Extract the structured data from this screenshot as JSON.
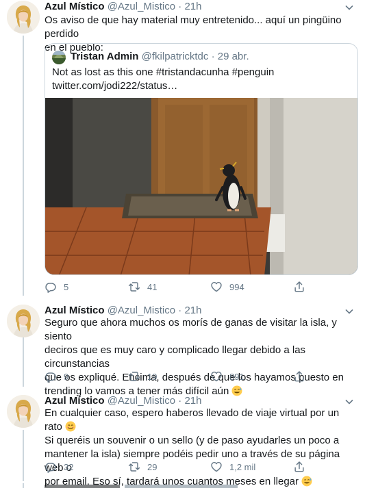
{
  "tweets": [
    {
      "name": "Azul Místico",
      "handle": "@Azul_Mistico",
      "sep": "·",
      "time": "21h",
      "text_lines": [
        "Os aviso de que hay material muy entretenido... aquí un pingüino perdido",
        "en el pueblo:"
      ],
      "quote": {
        "name": "Tristan Admin",
        "handle": "@fkilpatricktdc",
        "sep": "·",
        "time": "29 abr.",
        "text_lines": [
          "Not as lost as this one #tristandacunha #penguin",
          "twitter.com/jodi222/status…"
        ],
        "media_icon": "penguin-photo"
      },
      "replies": "5",
      "retweets": "41",
      "likes": "994"
    },
    {
      "name": "Azul Místico",
      "handle": "@Azul_Mistico",
      "sep": "·",
      "time": "21h",
      "text_lines": [
        "Seguro que ahora muchos os morís de ganas de visitar la isla, y siento",
        "deciros que es muy caro y complicado llegar debido a las circunstancias",
        "que os expliqué. Encima, después de que los hayamos puesto en",
        "trending lo vamos a tener más difícil aún"
      ],
      "replies": "9",
      "retweets": "19",
      "likes": "891"
    },
    {
      "name": "Azul Místico",
      "handle": "@Azul_Mistico",
      "sep": "·",
      "time": "21h",
      "text_lines": [
        "En cualquier caso, espero haberos llevado de viaje virtual por un rato",
        "Si queréis un souvenir o un sello (y de paso ayudarles un poco a",
        "mantener la isla) siempre podéis pedir uno a través de su página web o",
        "por email. Eso sí, tardará unos cuantos meses en llegar"
      ],
      "replies": "32",
      "retweets": "29",
      "likes": "1,2 mil"
    }
  ],
  "colors": {
    "text": "#14171a",
    "muted": "#657786",
    "border": "#ccd6dd"
  },
  "icons": [
    "reply-icon",
    "retweet-icon",
    "like-icon",
    "share-icon",
    "chevron-down-icon",
    "sweat-smile-emoji",
    "smile-emoji"
  ]
}
